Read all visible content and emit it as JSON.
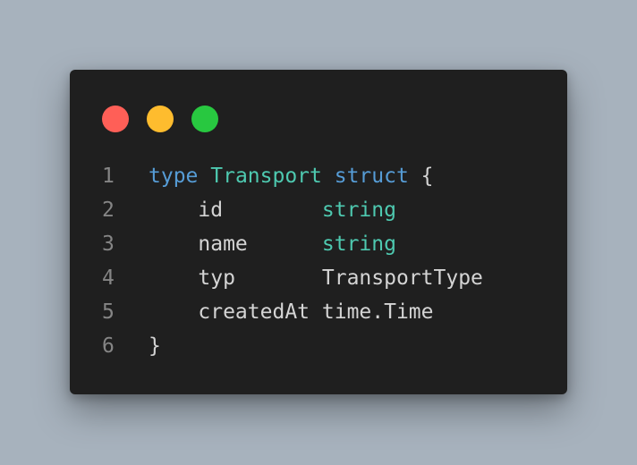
{
  "window_controls": {
    "close_color": "#ff5f57",
    "minimize_color": "#febc2e",
    "maximize_color": "#28c840"
  },
  "code": {
    "language": "go",
    "lines": [
      {
        "number": "1",
        "tokens": [
          {
            "text": "type",
            "kind": "keyword"
          },
          {
            "text": " ",
            "kind": "plain"
          },
          {
            "text": "Transport",
            "kind": "type"
          },
          {
            "text": " ",
            "kind": "plain"
          },
          {
            "text": "struct",
            "kind": "keyword"
          },
          {
            "text": " {",
            "kind": "plain"
          }
        ]
      },
      {
        "number": "2",
        "tokens": [
          {
            "text": "    id",
            "kind": "plain"
          },
          {
            "text": "        ",
            "kind": "plain"
          },
          {
            "text": "string",
            "kind": "type"
          }
        ]
      },
      {
        "number": "3",
        "tokens": [
          {
            "text": "    name",
            "kind": "plain"
          },
          {
            "text": "      ",
            "kind": "plain"
          },
          {
            "text": "string",
            "kind": "type"
          }
        ]
      },
      {
        "number": "4",
        "tokens": [
          {
            "text": "    typ",
            "kind": "plain"
          },
          {
            "text": "       ",
            "kind": "plain"
          },
          {
            "text": "TransportType",
            "kind": "plain"
          }
        ]
      },
      {
        "number": "5",
        "tokens": [
          {
            "text": "    createdAt",
            "kind": "plain"
          },
          {
            "text": " ",
            "kind": "plain"
          },
          {
            "text": "time.Time",
            "kind": "plain"
          }
        ]
      },
      {
        "number": "6",
        "tokens": [
          {
            "text": "}",
            "kind": "plain"
          }
        ]
      }
    ]
  },
  "colors": {
    "background": "#a7b2bd",
    "window": "#1f1f1f",
    "keyword": "#569cd6",
    "type": "#4ec9b0",
    "plain": "#d4d4d4",
    "line_number": "#858585"
  }
}
